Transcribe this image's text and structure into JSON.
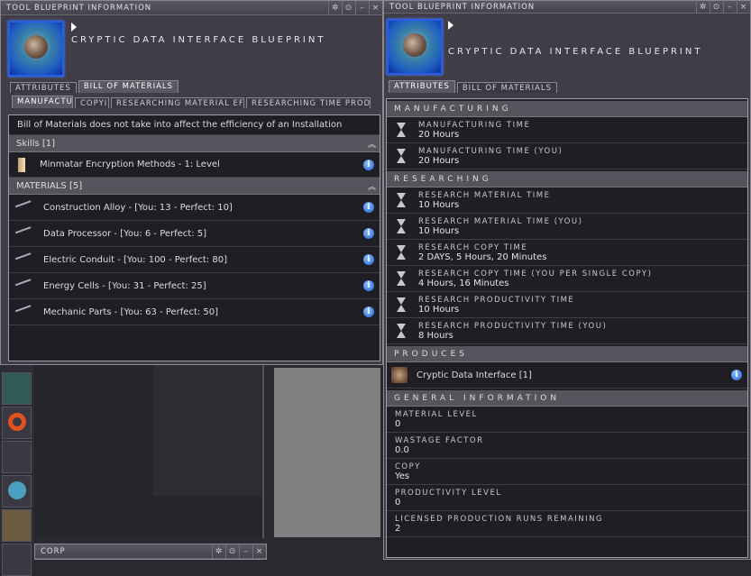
{
  "left_window": {
    "title": "TOOL BLUEPRINT INFORMATION",
    "blueprint_name": "CRYPTIC DATA INTERFACE BLUEPRINT",
    "tabs": [
      "ATTRIBUTES",
      "BILL OF MATERIALS"
    ],
    "subtabs": [
      "MANUFACTUF",
      "COPYI",
      "RESEARCHING MATERIAL EFF",
      "RESEARCHING TIME PRODU"
    ],
    "notice": "Bill of Materials does not take into affect the efficiency of an Installation",
    "skills_header": "Skills [1]",
    "skills": [
      "Minmatar Encryption Methods - 1: Level"
    ],
    "materials_header": "MATERIALS [5]",
    "materials": [
      "Construction Alloy - [You: 13 - Perfect: 10]",
      "Data Processor - [You: 6 - Perfect: 5]",
      "Electric Conduit - [You: 100 - Perfect: 80]",
      "Energy Cells - [You: 31 - Perfect: 25]",
      "Mechanic Parts - [You: 63 - Perfect: 50]"
    ]
  },
  "right_window": {
    "title": "TOOL BLUEPRINT INFORMATION",
    "blueprint_name": "CRYPTIC DATA INTERFACE BLUEPRINT",
    "tabs": [
      "ATTRIBUTES",
      "BILL OF MATERIALS"
    ],
    "manufacturing_header": "MANUFACTURING",
    "manufacturing": [
      {
        "label": "MANUFACTURING TIME",
        "value": "20 Hours"
      },
      {
        "label": "MANUFACTURING TIME (YOU)",
        "value": "20 Hours"
      }
    ],
    "researching_header": "RESEARCHING",
    "researching": [
      {
        "label": "RESEARCH MATERIAL TIME",
        "value": "10 Hours"
      },
      {
        "label": "RESEARCH MATERIAL TIME (YOU)",
        "value": "10 Hours"
      },
      {
        "label": "RESEARCH COPY TIME",
        "value": "2 DAYS, 5 Hours, 20 Minutes"
      },
      {
        "label": "RESEARCH COPY TIME (YOU PER SINGLE COPY)",
        "value": "4 Hours, 16 Minutes"
      },
      {
        "label": "RESEARCH PRODUCTIVITY TIME",
        "value": "10 Hours"
      },
      {
        "label": "RESEARCH PRODUCTIVITY TIME (YOU)",
        "value": "8 Hours"
      }
    ],
    "produces_header": "PRODUCES",
    "produces": "Cryptic Data Interface [1]",
    "general_header": "GENERAL INFORMATION",
    "general": [
      {
        "label": "MATERIAL LEVEL",
        "value": "0"
      },
      {
        "label": "WASTAGE FACTOR",
        "value": "0.0"
      },
      {
        "label": "COPY",
        "value": "Yes"
      },
      {
        "label": "PRODUCTIVITY LEVEL",
        "value": "0"
      },
      {
        "label": "LICENSED PRODUCTION RUNS REMAINING",
        "value": "2"
      }
    ]
  },
  "corp_window": {
    "title": "CORP"
  }
}
